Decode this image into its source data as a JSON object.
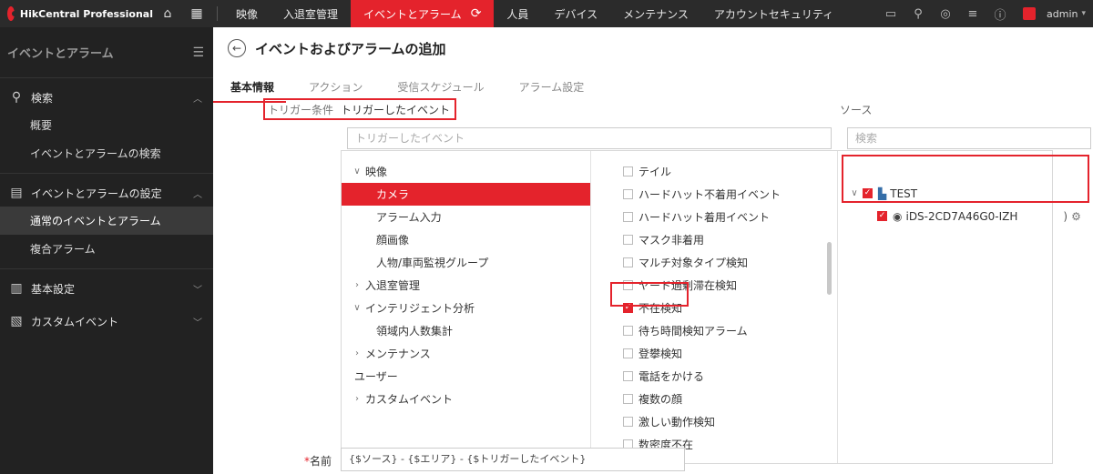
{
  "app": {
    "name": "HikCentral Professional"
  },
  "topnav": {
    "items": [
      "映像",
      "入退室管理",
      "イベントとアラーム",
      "人員",
      "デバイス",
      "メンテナンス",
      "アカウントセキュリティ"
    ],
    "active_index": 2,
    "user": "admin"
  },
  "sidebar": {
    "title": "イベントとアラーム",
    "groups": [
      {
        "label": "検索",
        "icon": "search-icon",
        "items": [
          "概要",
          "イベントとアラームの検索"
        ]
      },
      {
        "label": "イベントとアラームの設定",
        "icon": "clipboard-icon",
        "items": [
          "通常のイベントとアラーム",
          "複合アラーム"
        ]
      },
      {
        "label": "基本設定",
        "icon": "settings-panel-icon",
        "items": []
      },
      {
        "label": "カスタムイベント",
        "icon": "custom-event-icon",
        "items": []
      }
    ],
    "active_item": "通常のイベントとアラーム"
  },
  "page": {
    "title": "イベントおよびアラームの追加",
    "tabs": [
      "基本情報",
      "アクション",
      "受信スケジュール",
      "アラーム設定"
    ],
    "active_tab": 0
  },
  "trigger": {
    "label": "トリガー条件",
    "title": "トリガーしたイベント",
    "search_placeholder": "トリガーしたイベント"
  },
  "source": {
    "label": "ソース",
    "search_placeholder": "検索",
    "root": "TEST",
    "device": "iDS-2CD7A46G0-IZH",
    "device_suffix": ")"
  },
  "categories": [
    {
      "label": "映像",
      "expanded": true,
      "children": [
        "カメラ",
        "アラーム入力",
        "顔画像",
        "人物/車両監視グループ"
      ]
    },
    {
      "label": "入退室管理",
      "expanded": false,
      "children": []
    },
    {
      "label": "インテリジェント分析",
      "expanded": true,
      "children": [
        "領域内人数集計"
      ]
    },
    {
      "label": "メンテナンス",
      "expanded": false,
      "children": []
    },
    {
      "label": "ユーザー",
      "expanded": null,
      "children": []
    },
    {
      "label": "カスタムイベント",
      "expanded": false,
      "children": []
    }
  ],
  "selected_category": "カメラ",
  "events": [
    {
      "label": "テイル",
      "checked": false
    },
    {
      "label": "ハードハット不着用イベント",
      "checked": false
    },
    {
      "label": "ハードハット着用イベント",
      "checked": false
    },
    {
      "label": "マスク非着用",
      "checked": false
    },
    {
      "label": "マルチ対象タイプ検知",
      "checked": false
    },
    {
      "label": "ヤード過剰滞在検知",
      "checked": false
    },
    {
      "label": "不在検知",
      "checked": true
    },
    {
      "label": "待ち時間検知アラーム",
      "checked": false
    },
    {
      "label": "登攀検知",
      "checked": false
    },
    {
      "label": "電話をかける",
      "checked": false
    },
    {
      "label": "複数の顔",
      "checked": false
    },
    {
      "label": "激しい動作検知",
      "checked": false
    },
    {
      "label": "数密度不在",
      "checked": false
    }
  ],
  "name_field": {
    "required_mark": "*",
    "label": "名前",
    "value": "{$ソース} - {$エリア} - {$トリガーしたイベント}"
  },
  "colors": {
    "accent": "#e4232c",
    "topbar": "#2b2b2b",
    "sidebar": "#222222"
  }
}
